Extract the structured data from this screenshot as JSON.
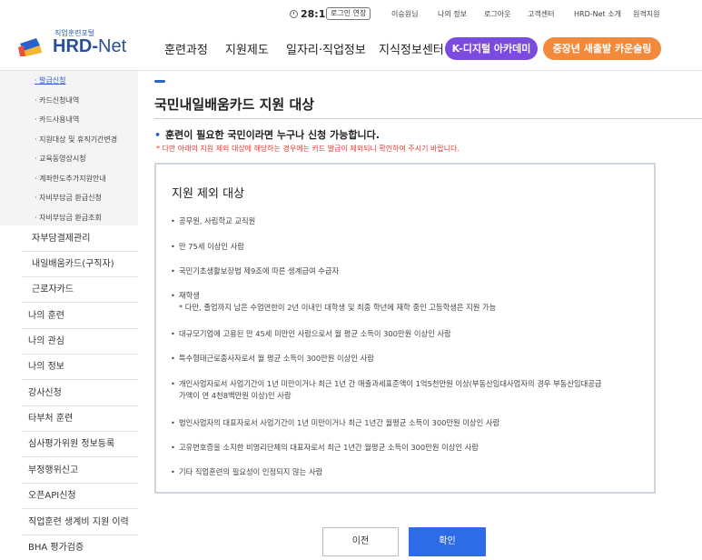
{
  "util": {
    "clock_time": "28:11",
    "extend_label": "로그인 연장",
    "links": [
      "이승원님",
      "나의 정보",
      "로그아웃",
      "고객센터",
      "HRD-Net 소개",
      "원격지원"
    ]
  },
  "header": {
    "logo_small": "직업훈련포털",
    "logo_hrd": "HRD-",
    "logo_net": "Net",
    "menus": [
      "훈련과정",
      "지원제도",
      "일자리·직업정보",
      "지식정보센터"
    ],
    "pill_purple": "K-디지털 아카데미",
    "pill_orange": "중장년 새출발 카운슬링"
  },
  "lnb": {
    "subs": [
      "· 발급신청",
      "· 카드신청내역",
      "· 카드사용내역",
      "· 지원대상 및 휴직기간변경",
      "· 교육동영상시청",
      "· 계좌한도추가지원안내",
      "· 자비부담금 환급신청",
      "· 자비부담금 환급조회"
    ],
    "lv2": [
      "자부담결제관리",
      "내일배움카드(구직자)",
      "근로자카드"
    ],
    "lv1": [
      "나의 훈련",
      "나의 관심",
      "나의 정보",
      "강사신청",
      "타부처 훈련",
      "심사평가위원 정보등록",
      "부정행위신고",
      "오픈API신청",
      "직업훈련 생계비 지원 이력",
      "BHA 평가검증"
    ]
  },
  "main": {
    "title": "국민내일배움카드 지원 대상",
    "lead": "훈련이 필요한 국민이라면 누구나 신청 가능합니다.",
    "notice": "* 다만 아래의 지원 제외 대상에 해당하는 경우에는 카드 발급이 제외되니 확인하여 주시기 바랍니다.",
    "box_title": "지원 제외 대상",
    "items": [
      {
        "text": "공무원, 사립학교 교직원"
      },
      {
        "text": "만 75세 이상인 사람"
      },
      {
        "text": "국민기초생활보장법 제9조에 따른 생계급여 수급자"
      },
      {
        "text": "재학생",
        "note": "* 다만, 졸업까지 남은 수업연한이 2년 이내인 대학생 및 최종 학년에 재학 중인 고등학생은 지원 가능"
      },
      {
        "text": "대규모기업에 고용된 만 45세 미만인 사람으로서 월 평균 소득이 300만원 이상인 사람"
      },
      {
        "text": "특수형태근로종사자로서 월 평균 소득이 300만원 이상인 사람"
      },
      {
        "text": "개인사업자로서 사업기간이 1년 미만이거나 최근 1년 간 매출과세표준액이 1억5천만원 이상(부동산임대사업자의 경우 부동산임대공급",
        "text2": "가액이 연 4천8백만원 이상)인 사람"
      },
      {
        "text": "법인사업자의 대표자로서 사업기간이 1년 미만이거나 최근 1년간 월평균 소득이 300만원 이상인 사람"
      },
      {
        "text": "고유번호증을 소지한 비영리단체의 대표자로서 최근 1년간 월평균 소득이 300만원 이상인 사람"
      },
      {
        "text": "기타 직업훈련의 필요성이 인정되지 않는 사람"
      }
    ],
    "bullet": "•",
    "btn_prev": "이전",
    "btn_ok": "확인"
  }
}
